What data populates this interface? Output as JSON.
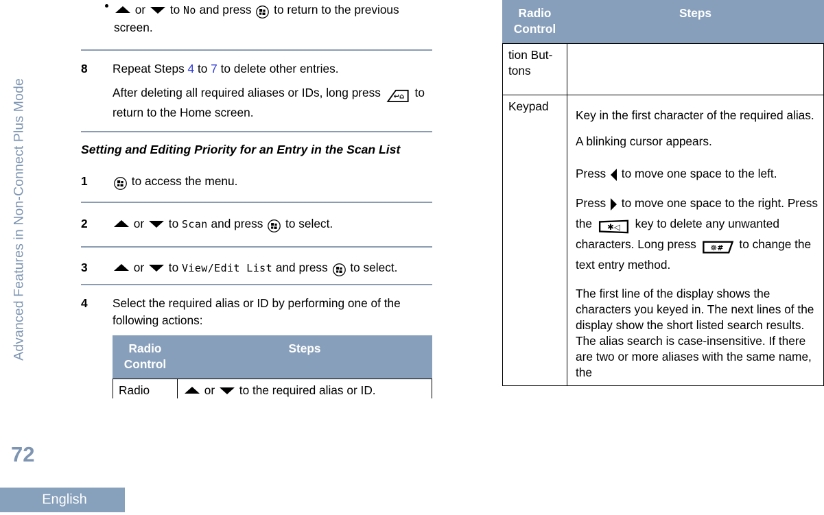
{
  "page": {
    "running_head": "Advanced Features in Non-Connect Plus Mode",
    "page_number": "72",
    "language": "English",
    "accent_color": "#879fbb",
    "rule_color": "#8b9cb1",
    "xref_color": "#2f3bd6"
  },
  "left_column": {
    "bullet_step": {
      "text_a": " or ",
      "text_b": " to ",
      "lcd_value": "No",
      "text_c": " and press ",
      "text_d": " to return to the previous screen."
    },
    "step8": {
      "number": "8",
      "line1_a": "Repeat Steps ",
      "line1_ref1": "4",
      "line1_b": " to ",
      "line1_ref2": "7",
      "line1_c": " to delete other entries.",
      "line2_a": "After deleting all required aliases or IDs, long press ",
      "line2_b": " to return to the Home screen."
    },
    "section_heading": "Setting and Editing Priority for an Entry in the Scan List",
    "step1": {
      "number": "1",
      "text_after_icon": " to access the menu."
    },
    "step2": {
      "number": "2",
      "text_a": " or ",
      "text_b": " to ",
      "lcd_value": "Scan",
      "text_c": " and press ",
      "text_d": " to select."
    },
    "step3": {
      "number": "3",
      "text_a": " or ",
      "text_b": " to ",
      "lcd_value": "View/Edit List",
      "text_c": " and press ",
      "text_d": " to select."
    },
    "step4": {
      "number": "4",
      "intro": "Select the required alias or ID by performing one of the following actions:",
      "table": {
        "headers": [
          "Radio Control",
          "Steps"
        ],
        "rows": [
          {
            "control": "Radio Naviga-",
            "steps_a": " or ",
            "steps_b": " to the required alias or ID."
          }
        ]
      }
    }
  },
  "right_column": {
    "table": {
      "headers": [
        "Radio Control",
        "Steps"
      ],
      "rows": [
        {
          "control": "tion But- tons",
          "paragraphs": []
        },
        {
          "control": "Keypad",
          "paragraphs": [
            "Key in the first character of the required alias.",
            "A blinking cursor appears.",
            "The first line of the display shows the characters you keyed in. The next lines of the display show the short listed search results. The alias search is case-insensitive. If there are two or more aliases with the same name, the"
          ],
          "press_left_a": "Press ",
          "press_left_b": " to move one space to the left.",
          "press_right_a": "Press ",
          "press_right_b": " to move one space to the right. Press the ",
          "press_right_c": " key to delete any unwanted characters. Long press ",
          "press_right_d": " to change the text entry method."
        }
      ]
    }
  },
  "icons": {
    "up": "up-arrow-icon",
    "down": "down-arrow-icon",
    "left": "left-arrow-icon",
    "right": "right-arrow-icon",
    "menu": "menu-button-icon",
    "back": "back-home-key-icon",
    "star": "star-delete-key-icon",
    "hash": "hash-text-entry-key-icon"
  }
}
